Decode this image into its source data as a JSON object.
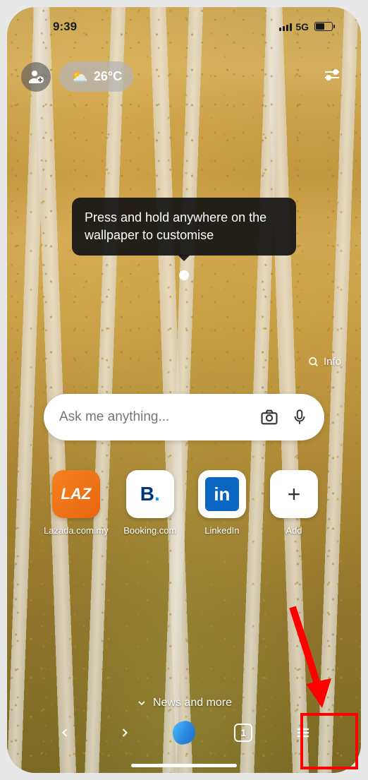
{
  "status_bar": {
    "time": "9:39",
    "network": "5G"
  },
  "weather": {
    "temperature": "26°C",
    "icon": "⛅"
  },
  "tooltip": {
    "text": "Press and hold anywhere on the wallpaper to customise"
  },
  "info_button": {
    "label": "Info"
  },
  "search": {
    "placeholder": "Ask me anything..."
  },
  "quick_links": [
    {
      "label": "Lazada.com.my",
      "icon_text": "LAZ"
    },
    {
      "label": "Booking.com",
      "icon_text": "B"
    },
    {
      "label": "LinkedIn",
      "icon_text": "in"
    },
    {
      "label": "Add",
      "icon_text": "+"
    }
  ],
  "news": {
    "label": "News and more"
  },
  "nav": {
    "tabs_count": "1"
  }
}
